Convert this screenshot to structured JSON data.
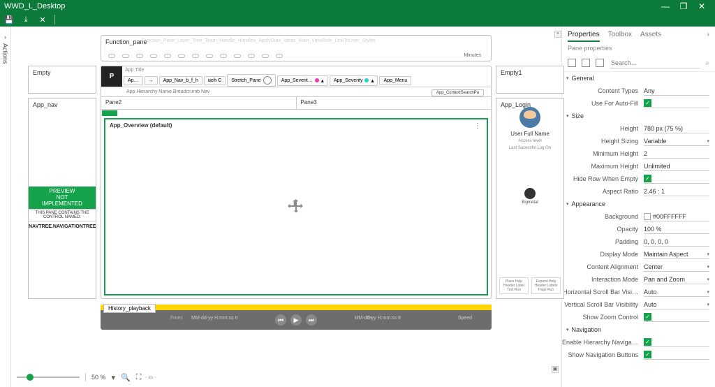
{
  "title": "WWD_L_Desktop",
  "win_btns": {
    "min": "—",
    "max": "❐",
    "close": "✕"
  },
  "toolbar": {
    "save": "💾",
    "export": "⤓",
    "close": "✕"
  },
  "actions_rail": {
    "label": "Actions",
    "chev": "›"
  },
  "function_pane": {
    "title": "Function_pane",
    "ghost": "Function_Pane_Layer_Tree_Team_Handle_Handles_ApplyData_Ideas_Main_ViewRole_LinkToUser_Styles",
    "minutes": "Minutes"
  },
  "empty_left": "Empty",
  "app_nav": {
    "label": "App_nav",
    "preview_line1": "PREVIEW",
    "preview_line2": "NOT",
    "preview_line3": "IMPLEMENTED",
    "pane_info": "THIS PANE CONTAINS THE CONTROL NAMED:",
    "navtree": "NAVTREE.NAVIGATIONTREE"
  },
  "center": {
    "app_title": "App Title",
    "tab_ap": "Ap…",
    "arrow": "→",
    "tab_nav": "App_Nav_b_f_h",
    "tab_touch": "uch C",
    "tab_stretch": "Stretch_Pane",
    "tab_sev1": "App_Severit…",
    "tab_sev2": "App_Severity",
    "tab_menu": "App_Menu",
    "breadcrumb": "App   Hierarchy   Name   Breadcrumb   Nav",
    "context_search": "App_ContextSearchPa",
    "pane2": "Pane2",
    "pane3": "Pane3",
    "overview": "App_Overview (default)",
    "kebab": "⋮"
  },
  "empty_right": "Empty1",
  "app_login": {
    "label": "App_Login",
    "user": "User Full Name",
    "access": "Access level",
    "lastlog": "Last Sucessful Log On",
    "fp": "Bigmetal",
    "mini1": "Place Help Header Label Test Run",
    "mini2": "Expand Help Header Labels Page Run"
  },
  "history": {
    "tab": "History_playback",
    "from_pre": "From:",
    "from": "MM-dd-yy H:mm:ss tt",
    "to_pre": "To:",
    "to": "MM-dd-yy H:mm:ss tt",
    "speed": "Speed"
  },
  "zoom": {
    "pct": "50 %",
    "fit": "⛶",
    "fitw": "⇔"
  },
  "props": {
    "tabs": {
      "properties": "Properties",
      "toolbox": "Toolbox",
      "assets": "Assets"
    },
    "subtitle": "Pane properties",
    "search_ph": "Search…",
    "sections": {
      "general": "General",
      "size": "Size",
      "appearance": "Appearance",
      "navigation": "Navigation"
    },
    "general": {
      "content_types_l": "Content Types",
      "content_types_v": "Any",
      "use_autofill_l": "Use For Auto-Fill"
    },
    "size": {
      "height_l": "Height",
      "height_v": "780 px (75 %)",
      "hsizing_l": "Height Sizing",
      "hsizing_v": "Variable",
      "minh_l": "Minimum Height",
      "minh_v": "2",
      "maxh_l": "Maximum Height",
      "maxh_v": "Unlimited",
      "hide_l": "Hide Row When Empty",
      "aspect_l": "Aspect Ratio",
      "aspect_v": "2.46 : 1"
    },
    "appearance": {
      "bg_l": "Background",
      "bg_v": "#00FFFFFF",
      "op_l": "Opacity",
      "op_v": "100 %",
      "pad_l": "Padding",
      "pad_v": "0, 0, 0, 0",
      "dm_l": "Display Mode",
      "dm_v": "Maintain Aspect",
      "ca_l": "Content Alignment",
      "ca_v": "Center",
      "im_l": "Interaction Mode",
      "im_v": "Pan and Zoom",
      "hsb_l": "Horizontal Scroll Bar Visi…",
      "hsb_v": "Auto",
      "vsb_l": "Vertical Scroll Bar Visibility",
      "vsb_v": "Auto",
      "zoom_l": "Show Zoom Control"
    },
    "navigation": {
      "hier_l": "Enable Hierarchy Navigat…",
      "navbtn_l": "Show Navigation Buttons"
    }
  }
}
